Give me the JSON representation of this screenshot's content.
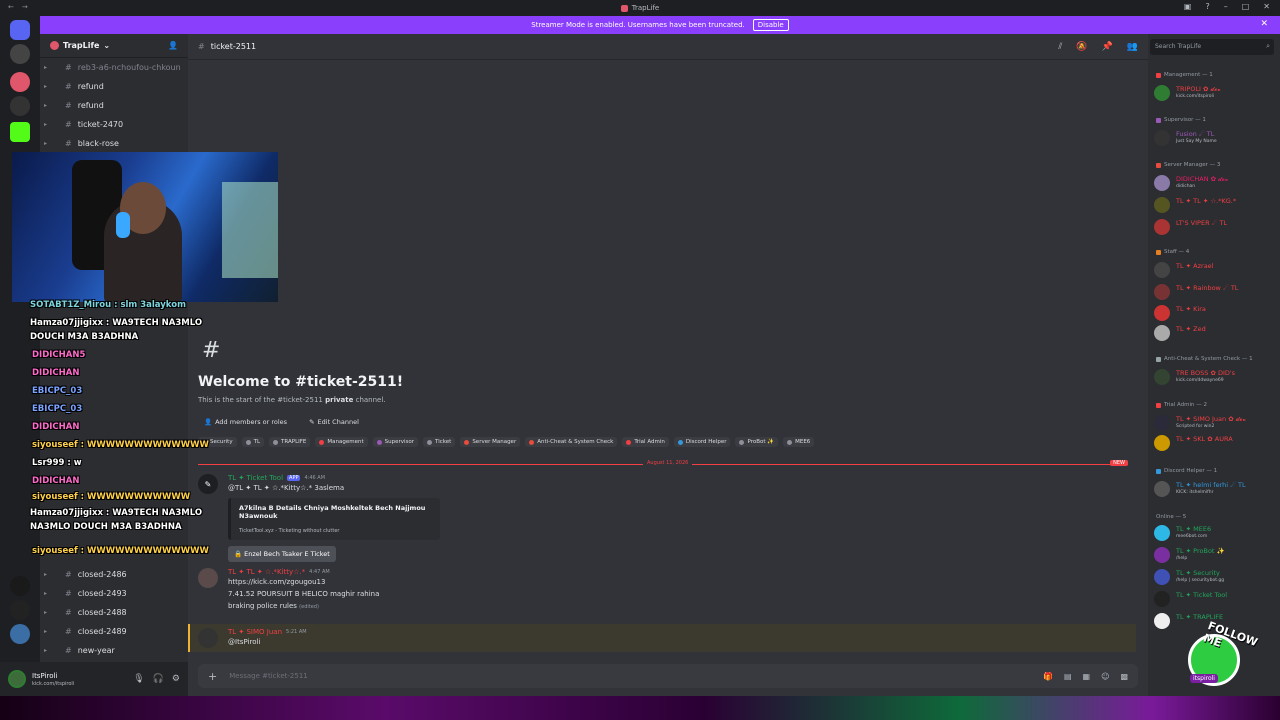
{
  "titlebar": {
    "title": "TrapLife"
  },
  "streamer": {
    "text": "Streamer Mode is enabled. Usernames have been truncated.",
    "button": "Disable"
  },
  "guild": {
    "name": "TrapLife"
  },
  "channels": [
    {
      "name": "reb3-a6-nchoufou-chkoun",
      "dim": true
    },
    {
      "name": "refund"
    },
    {
      "name": "refund"
    },
    {
      "name": "ticket-2470"
    },
    {
      "name": "black-rose"
    },
    {
      "name": "closed-2486"
    },
    {
      "name": "closed-2493"
    },
    {
      "name": "closed-2488"
    },
    {
      "name": "closed-2489"
    },
    {
      "name": "new-year"
    }
  ],
  "user": {
    "name": "ItsPiroli",
    "status": "kick.com/itspiroli",
    "new_badge": "NEW"
  },
  "header": {
    "channel": "ticket-2511",
    "search_placeholder": "Search TrapLife"
  },
  "welcome": {
    "title": "Welcome to #ticket-2511!",
    "sub_prefix": "This is the start of the #ticket-2511",
    "sub_bold": "private",
    "sub_suffix": "channel.",
    "add_members": "Add members or roles",
    "edit_channel": "Edit Channel"
  },
  "roles": [
    {
      "name": "Security",
      "color": "#8d9099"
    },
    {
      "name": "TL",
      "color": "#8d9099"
    },
    {
      "name": "TRAPLIFE",
      "color": "#8d9099"
    },
    {
      "name": "Management",
      "color": "#f23f43"
    },
    {
      "name": "Supervisor",
      "color": "#9b59b6"
    },
    {
      "name": "Ticket",
      "color": "#8d9099"
    },
    {
      "name": "Server Manager",
      "color": "#e74c3c"
    },
    {
      "name": "Anti-Cheat & System Check",
      "color": "#e74c3c"
    },
    {
      "name": "Trial Admin",
      "color": "#f23f43"
    },
    {
      "name": "Discord Helper",
      "color": "#3498db"
    },
    {
      "name": "ProBot ✨",
      "color": "#8d9099"
    },
    {
      "name": "MEE6",
      "color": "#8d9099"
    }
  ],
  "divider": {
    "date": "August 11, 2026",
    "new": "NEW"
  },
  "messages": [
    {
      "author": "TL ✦ Ticket Tool",
      "badge": "APP",
      "time": "4:46 AM",
      "mention": "@TL ✦ TL ✦ ☆.*Kitty☆.* 3aslema",
      "embed_title": "A7kilna B Details Chniya Moshkeltek Bech Najjmou N3awnouk",
      "embed_footer": "TicketTool.xyz - Ticketing without clutter",
      "button": "Enzel Bech Tsaker E Ticket"
    },
    {
      "author": "TL ✦ TL ✦ ☆.*Kitty☆.*",
      "time": "4:47 AM",
      "link": "https://kick.com/zgougou13",
      "line1": "7.41.52 POURSUIT B HELICO maghir rahina",
      "line2": "braking police rules",
      "edited": "(edited)"
    },
    {
      "author": "TL ✦ SIMO Juan",
      "time": "5:21 AM",
      "mention": "@ItsPiroli"
    }
  ],
  "composer": {
    "placeholder": "Message #ticket-2511"
  },
  "members": {
    "groups": [
      {
        "label": "Management — 1",
        "color": "#f23f43"
      },
      {
        "label": "Supervisor — 1",
        "color": "#9b59b6"
      },
      {
        "label": "Server Manager — 3",
        "color": "#e74c3c"
      },
      {
        "label": "Staff — 4",
        "color": "#e67e22"
      },
      {
        "label": "Anti-Cheat & System Check — 1",
        "color": "#95a5a6"
      },
      {
        "label": "Trial Admin — 2",
        "color": "#f23f43"
      },
      {
        "label": "Discord Helper — 1",
        "color": "#3498db"
      },
      {
        "label": "Online — 5",
        "color": ""
      }
    ],
    "list": [
      {
        "name": "TRIPOLI ✿ 𝓭𝓮𝓿",
        "status": "kick.com/itspiroli",
        "color": "#f23f43"
      },
      {
        "name": "Fusion ☄ TL",
        "status": "Just Say My Name",
        "color": "#9b59b6"
      },
      {
        "name": "DIDICHAN ✿ 𝓭𝓮𝓿",
        "status": "didichan",
        "color": "#e91e63"
      },
      {
        "name": "TL ✦ TL ✦ ☆.*KG.*",
        "status": "",
        "color": "#f23f43"
      },
      {
        "name": "LT'S VIPER ☄ TL",
        "status": "",
        "color": "#f23f43"
      },
      {
        "name": "TL ✦ Azrael",
        "status": "",
        "color": "#f23f43"
      },
      {
        "name": "TL ✦ Rainbow ☄ TL",
        "status": "",
        "color": "#f23f43"
      },
      {
        "name": "TL ✦ Kira",
        "status": "",
        "color": "#f23f43"
      },
      {
        "name": "TL ✦ Zed",
        "status": "",
        "color": "#f23f43"
      },
      {
        "name": "TRE BOSS ✿ DID's",
        "status": "kick.com/ddwayne69",
        "color": "#f23f43"
      },
      {
        "name": "TL ✦ SIMO Juan ✿ 𝓭𝓮𝓿",
        "status": "Scripted for win2",
        "color": "#f23f43"
      },
      {
        "name": "TL ✦ SKL ✿ AURA",
        "status": "",
        "color": "#f23f43"
      },
      {
        "name": "TL ✦ helmi ferhi ☄ TL",
        "status": "KICK: itshelmifhr",
        "color": "#3498db"
      },
      {
        "name": "TL ✦ MEE6",
        "status": "mee6bot.com",
        "color": "#23a55a"
      },
      {
        "name": "TL ✦ ProBot ✨",
        "status": "/help",
        "color": "#23a55a"
      },
      {
        "name": "TL ✦ Security",
        "status": "/help | securitybot.gg",
        "color": "#23a55a"
      },
      {
        "name": "TL ✦ Ticket Tool",
        "status": "",
        "color": "#23a55a"
      },
      {
        "name": "TL ✦ TRAPLIFE",
        "status": "",
        "color": "#23a55a"
      }
    ]
  },
  "overlay_chat": [
    {
      "text": "SOTABT1Z_Mirou : slm 3alaykom",
      "color": "#7ed6df"
    },
    {
      "text": "Hamza07jjigixx : WA9TECH NA3MLO",
      "color": "#ffffff"
    },
    {
      "text": "DOUCH M3A B3ADHNA",
      "color": "#ffffff"
    },
    {
      "text": "DIDICHAN5",
      "color": "#ff6bcb"
    },
    {
      "text": "DIDICHAN",
      "color": "#ff6bcb"
    },
    {
      "text": "EBICPC_03",
      "color": "#7aa2ff"
    },
    {
      "text": "EBICPC_03",
      "color": "#7aa2ff"
    },
    {
      "text": "DIDICHAN",
      "color": "#ff6bcb"
    },
    {
      "text": "siyouseef : WWWWWWWWWWWWW",
      "color": "#ffd24a"
    },
    {
      "text": "Lsr999 : w",
      "color": "#ffffff"
    },
    {
      "text": "DIDICHAN",
      "color": "#ff6bcb"
    },
    {
      "text": "siyouseef : WWWWWWWWWWW",
      "color": "#ffd24a"
    },
    {
      "text": "Hamza07jjigixx : WA9TECH NA3MLO",
      "color": "#ffffff"
    },
    {
      "text": "NA3MLO DOUCH M3A B3ADHNA",
      "color": "#ffffff"
    },
    {
      "text": "siyouseef : WWWWWWWWWWWWW",
      "color": "#ffd24a"
    }
  ],
  "sticker": {
    "text": "FOLLOW ME",
    "label": "itspiroli"
  }
}
